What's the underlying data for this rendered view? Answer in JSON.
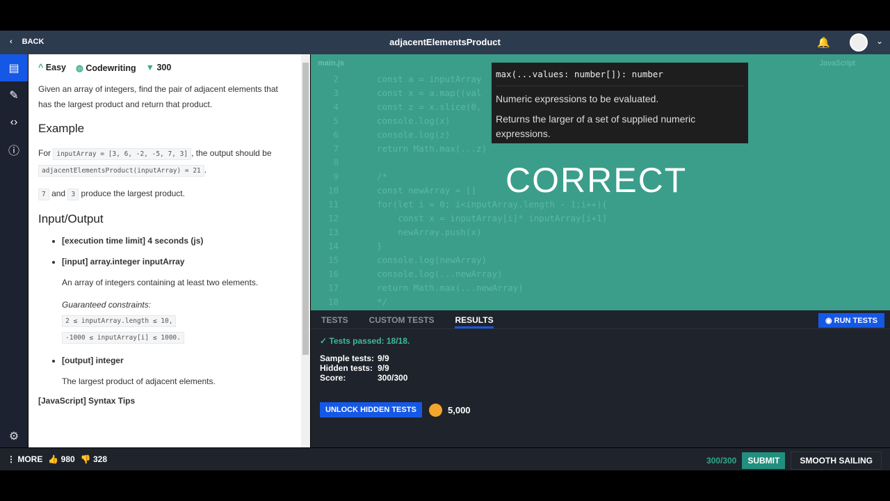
{
  "header": {
    "back": "BACK",
    "title": "adjacentElementsProduct"
  },
  "meta": {
    "difficulty": "Easy",
    "type": "Codewriting",
    "points": "300"
  },
  "description": {
    "intro": "Given an array of integers, find the pair of adjacent elements that has the largest product and return that product.",
    "example_heading": "Example",
    "for": "For",
    "example_input": "inputArray = [3, 6, -2, -5, 7, 3]",
    "output_should_be": ", the output should be",
    "example_output": "adjacentElementsProduct(inputArray) = 21",
    "period": ".",
    "val1": "7",
    "and": "and",
    "val2": "3",
    "produce": "produce the largest product.",
    "io_heading": "Input/Output",
    "time_limit": "[execution time limit] 4 seconds (js)",
    "input": "[input] array.integer inputArray",
    "input_desc": "An array of integers containing at least two elements.",
    "constraints_label": "Guaranteed constraints:",
    "c1": "2 ≤ inputArray.length ≤ 10,",
    "c2": "-1000 ≤ inputArray[i] ≤ 1000.",
    "output": "[output] integer",
    "output_desc": "The largest product of adjacent elements.",
    "syntax": "[JavaScript] Syntax Tips"
  },
  "editor": {
    "filename": "main.js",
    "language": "JavaScript",
    "lines": [
      {
        "n": "2",
        "t": "const a = inputArray"
      },
      {
        "n": "3",
        "t": "const x = a.map((val"
      },
      {
        "n": "4",
        "t": "const z = x.slice(0,"
      },
      {
        "n": "5",
        "t": "console.log(x)"
      },
      {
        "n": "6",
        "t": "console.log(z)"
      },
      {
        "n": "7",
        "t": "return Math.max(...z)"
      },
      {
        "n": "8",
        "t": ""
      },
      {
        "n": "9",
        "t": "/*"
      },
      {
        "n": "10",
        "t": "const newArray = []"
      },
      {
        "n": "11",
        "t": "for(let i = 0; i<inputArray.length - 1;i++){"
      },
      {
        "n": "12",
        "t": "    const x = inputArray[i]* inputArray[i+1]"
      },
      {
        "n": "13",
        "t": "    newArray.push(x)"
      },
      {
        "n": "14",
        "t": "}"
      },
      {
        "n": "15",
        "t": "console.log(newArray)"
      },
      {
        "n": "16",
        "t": "console.log(...newArray)"
      },
      {
        "n": "17",
        "t": "return Math.max(...newArray)"
      },
      {
        "n": "18",
        "t": "*/"
      }
    ],
    "tooltip": {
      "signature": "max(...values: number[]): number",
      "param": "Numeric expressions to be evaluated.",
      "desc": "Returns the larger of a set of supplied numeric expressions."
    },
    "overlay": "CORRECT"
  },
  "results": {
    "tabs": [
      "TESTS",
      "CUSTOM TESTS",
      "RESULTS"
    ],
    "run": "RUN TESTS",
    "passed": "Tests passed: 18/18.",
    "sample_label": "Sample tests:",
    "sample": "9/9",
    "hidden_label": "Hidden tests:",
    "hidden": "9/9",
    "score_label": "Score:",
    "score": "300/300",
    "unlock": "UNLOCK HIDDEN TESTS",
    "coins": "5,000"
  },
  "footer": {
    "more": "MORE",
    "likes": "980",
    "dislikes": "328",
    "score": "300/300",
    "submit": "SUBMIT",
    "smooth": "SMOOTH SAILING"
  }
}
